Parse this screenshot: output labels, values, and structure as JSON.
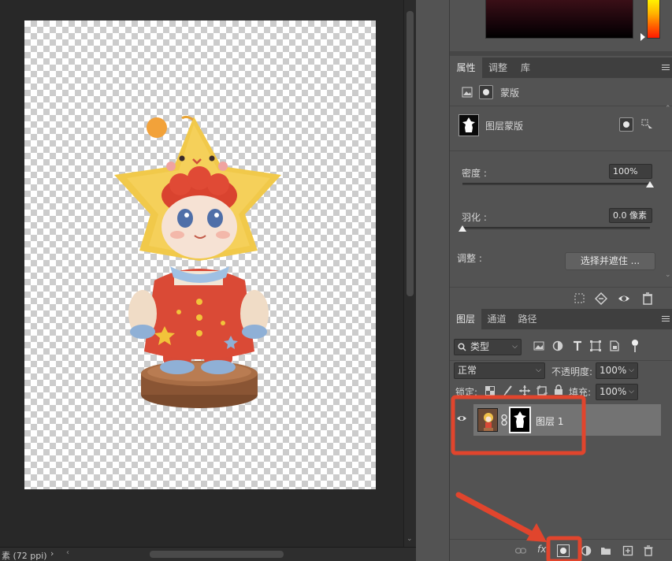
{
  "status_bar": {
    "doc_info": "素 (72 ppi)",
    "chevron": "›",
    "left_arrow": "‹",
    "right_arrow": "›"
  },
  "color_picker": {
    "field_color": "#120308",
    "hue_indicator_color": "#ff6a00"
  },
  "properties_panel": {
    "tabs": [
      {
        "label": "属性",
        "active": true
      },
      {
        "label": "调整",
        "active": false
      },
      {
        "label": "库",
        "active": false
      }
    ],
    "mode_label": "蒙版",
    "mask_title": "图层蒙版",
    "density": {
      "label": "密度 :",
      "value": "100%",
      "fraction": 1.0
    },
    "feather": {
      "label": "羽化 :",
      "value": "0.0 像素",
      "fraction": 0.0
    },
    "adjust": {
      "label": "调整 :",
      "button_label": "选择并遮住 ..."
    }
  },
  "layers_panel": {
    "tabs": [
      {
        "label": "图层",
        "active": true
      },
      {
        "label": "通道",
        "active": false
      },
      {
        "label": "路径",
        "active": false
      }
    ],
    "filter_kind": "类型",
    "blend_mode": "正常",
    "opacity_label": "不透明度:",
    "opacity_value": "100%",
    "lock_label": "锁定:",
    "fill_label": "填充:",
    "fill_value": "100%",
    "layers": [
      {
        "name": "图层 1",
        "visible": true,
        "has_mask": true
      }
    ],
    "footer_fx_label": "fx"
  },
  "annotations": {
    "highlight_color": "#e1452d"
  }
}
